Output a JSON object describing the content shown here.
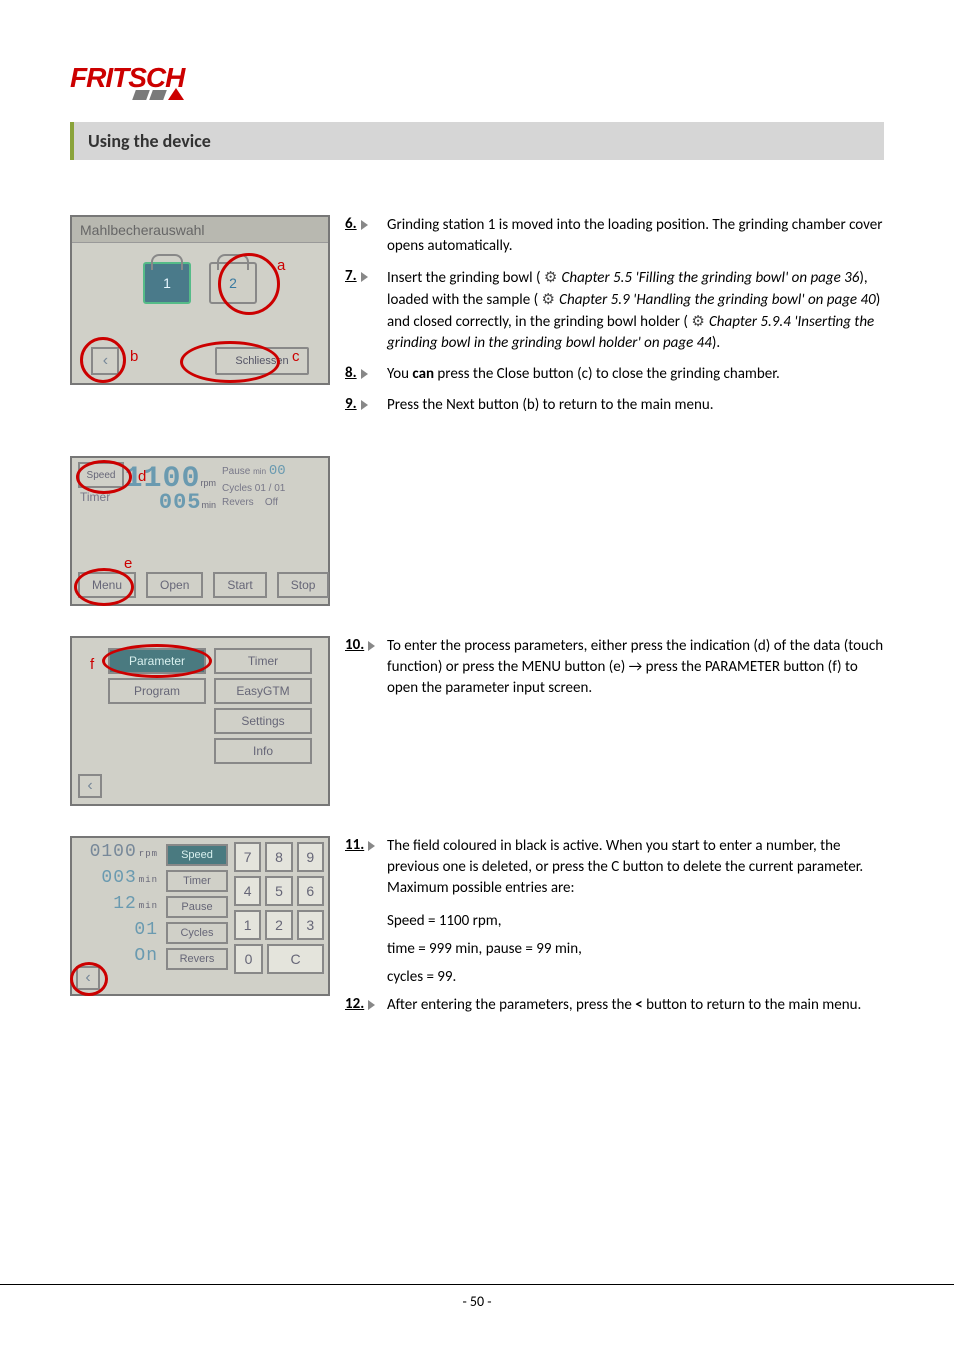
{
  "logo": {
    "brand": "FRITSCH"
  },
  "section_title": "Using the device",
  "shot1": {
    "title": "Mahlbecherauswahl",
    "bowl1": "1",
    "bowl2": "2",
    "close_btn": "Schliessen",
    "label_a": "a",
    "label_b": "b",
    "label_c": "c"
  },
  "shot2": {
    "speed_label": "Speed",
    "timer_label": "Timer",
    "speed_val": "1100",
    "speed_unit": "rpm",
    "timer_val": "005",
    "timer_unit": "min",
    "pause_label": "Pause",
    "pause_unit": "min",
    "pause_val": "00",
    "cycles_label": "Cycles 01 / 01",
    "revers_label": "Revers",
    "revers_val": "Off",
    "menu": "Menu",
    "open": "Open",
    "start": "Start",
    "stop": "Stop",
    "label_d": "d",
    "label_e": "e"
  },
  "shot3": {
    "parameter": "Parameter",
    "timer": "Timer",
    "program": "Program",
    "easygtm": "EasyGTM",
    "settings": "Settings",
    "info": "Info",
    "label_f": "f"
  },
  "shot4": {
    "speed": {
      "val": "0100",
      "unit": "rpm"
    },
    "timer": {
      "val": "003",
      "unit": "min"
    },
    "pause": {
      "val": "12",
      "unit": "min"
    },
    "cycles": {
      "val": "01",
      "unit": ""
    },
    "revers": {
      "val": "On",
      "unit": ""
    },
    "labels": {
      "speed": "Speed",
      "timer": "Timer",
      "pause": "Pause",
      "cycles": "Cycles",
      "revers": "Revers"
    },
    "keys": {
      "k7": "7",
      "k8": "8",
      "k9": "9",
      "k4": "4",
      "k5": "5",
      "k6": "6",
      "k1": "1",
      "k2": "2",
      "k3": "3",
      "k0": "0",
      "kc": "C"
    }
  },
  "steps": {
    "s6": {
      "num": "6.",
      "text": "Grinding station 1 is moved into the loading position. The grinding chamber cover opens automatically."
    },
    "s7": {
      "num": "7.",
      "pre": "Insert the grinding bowl ( ",
      "ref1": "Chapter 5.5 'Filling the grinding bowl' on page 36",
      "mid1": "), loaded with the sample ( ",
      "ref2": "Chapter 5.9 'Handling the grinding bowl' on page 40",
      "mid2": ") and closed correctly, in the grinding bowl holder ( ",
      "ref3": "Chapter 5.9.4 'Inserting the grinding bowl in the grinding bowl holder' on page 44",
      "post": ")."
    },
    "s8": {
      "num": "8.",
      "pre": "You ",
      "bold": "can",
      "post": " press the Close button (c) to close the grinding chamber."
    },
    "s9": {
      "num": "9.",
      "text": "Press the Next button (b) to return to the main menu."
    },
    "s10": {
      "num": "10.",
      "text": "To enter the process parameters, either press the indication (d) of the data (touch function) or press the MENU button (e) → press the PARAMETER button (f) to open the parameter input screen."
    },
    "s11": {
      "num": "11.",
      "text": "The field coloured in black is active. When you start to enter a number, the previous one is deleted, or press the C button to delete the current parameter. Maximum possible entries are:",
      "sub1": "Speed = 1100 rpm,",
      "sub2": "time = 999 min, pause = 99 min,",
      "sub3": "cycles = 99."
    },
    "s12": {
      "num": "12.",
      "pre": "After entering the parameters, press the ",
      "bold": "<",
      "post": " button to return to the main menu."
    }
  },
  "footer": {
    "page": "- 50 -"
  }
}
